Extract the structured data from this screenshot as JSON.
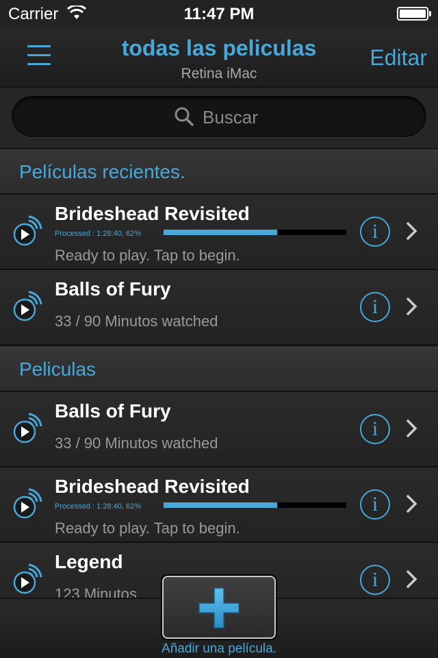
{
  "status_bar": {
    "carrier": "Carrier",
    "time": "11:47 PM"
  },
  "nav": {
    "title": "todas las peliculas",
    "subtitle": "Retina iMac",
    "edit_label": "Editar"
  },
  "search": {
    "placeholder": "Buscar"
  },
  "sections": {
    "recent": {
      "header": "Películas recientes.",
      "items": [
        {
          "title": "Brideshead Revisited",
          "processed": "Processed : 1:28:40, 62%",
          "progress": 0.62,
          "subtitle": "Ready to play. Tap to begin."
        },
        {
          "title": "Balls of Fury",
          "subtitle": "33 / 90 Minutos watched"
        }
      ]
    },
    "movies": {
      "header": "Peliculas",
      "items": [
        {
          "title": "Balls of Fury",
          "subtitle": "33 / 90 Minutos watched"
        },
        {
          "title": "Brideshead Revisited",
          "processed": "Processed : 1:28:40, 62%",
          "progress": 0.62,
          "subtitle": "Ready to play. Tap to begin."
        },
        {
          "title": "Legend",
          "subtitle": "123 Minutos"
        }
      ]
    }
  },
  "toolbar": {
    "add_label": "Añadir una película."
  },
  "colors": {
    "accent": "#4aa8d8",
    "background": "#1e1e1f"
  },
  "icons": [
    "wifi-icon",
    "battery-icon",
    "menu-icon",
    "search-icon",
    "play-stream-icon",
    "info-icon",
    "chevron-right-icon",
    "plus-icon"
  ]
}
